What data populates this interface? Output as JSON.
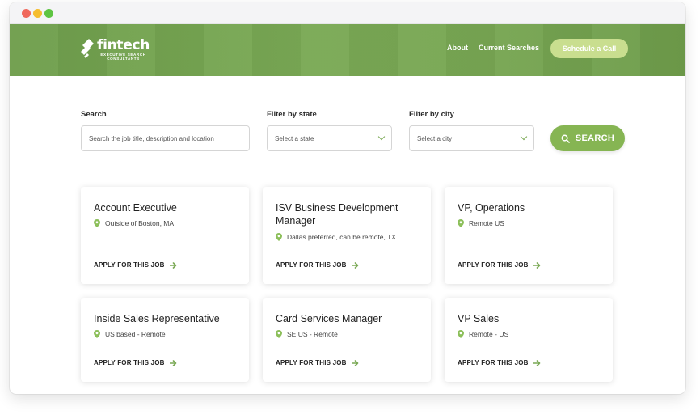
{
  "header": {
    "logo_word": "fintech",
    "logo_sub_1": "EXECUTIVE SEARCH",
    "logo_sub_2": "CONSULTANTS",
    "nav": [
      {
        "label": "About"
      },
      {
        "label": "Current Searches"
      }
    ],
    "cta_label": "Schedule a Call"
  },
  "filters": {
    "search_label": "Search",
    "search_placeholder": "Search the job title, description and location",
    "state_label": "Filter by state",
    "state_value": "Select a state",
    "city_label": "Filter by city",
    "city_value": "Select a city",
    "search_button": "SEARCH"
  },
  "jobs": [
    {
      "title": "Account Executive",
      "location": "Outside of Boston, MA",
      "apply": "APPLY FOR THIS JOB"
    },
    {
      "title": "ISV Business Development Manager",
      "location": "Dallas preferred, can be remote, TX",
      "apply": "APPLY FOR THIS JOB"
    },
    {
      "title": "VP, Operations",
      "location": "Remote US",
      "apply": "APPLY FOR THIS JOB"
    },
    {
      "title": "Inside Sales Representative",
      "location": "US based - Remote",
      "apply": "APPLY FOR THIS JOB"
    },
    {
      "title": "Card Services Manager",
      "location": "SE US - Remote",
      "apply": "APPLY FOR THIS JOB"
    },
    {
      "title": "VP Sales",
      "location": "Remote - US",
      "apply": "APPLY FOR THIS JOB"
    }
  ],
  "colors": {
    "brand_green": "#7aa955",
    "cta_green": "#c9de8f",
    "search_green": "#86b553"
  },
  "icons": {
    "pin": "map-pin-icon",
    "arrow": "arrow-right-icon",
    "search": "search-icon",
    "chevron": "chevron-down-icon"
  }
}
